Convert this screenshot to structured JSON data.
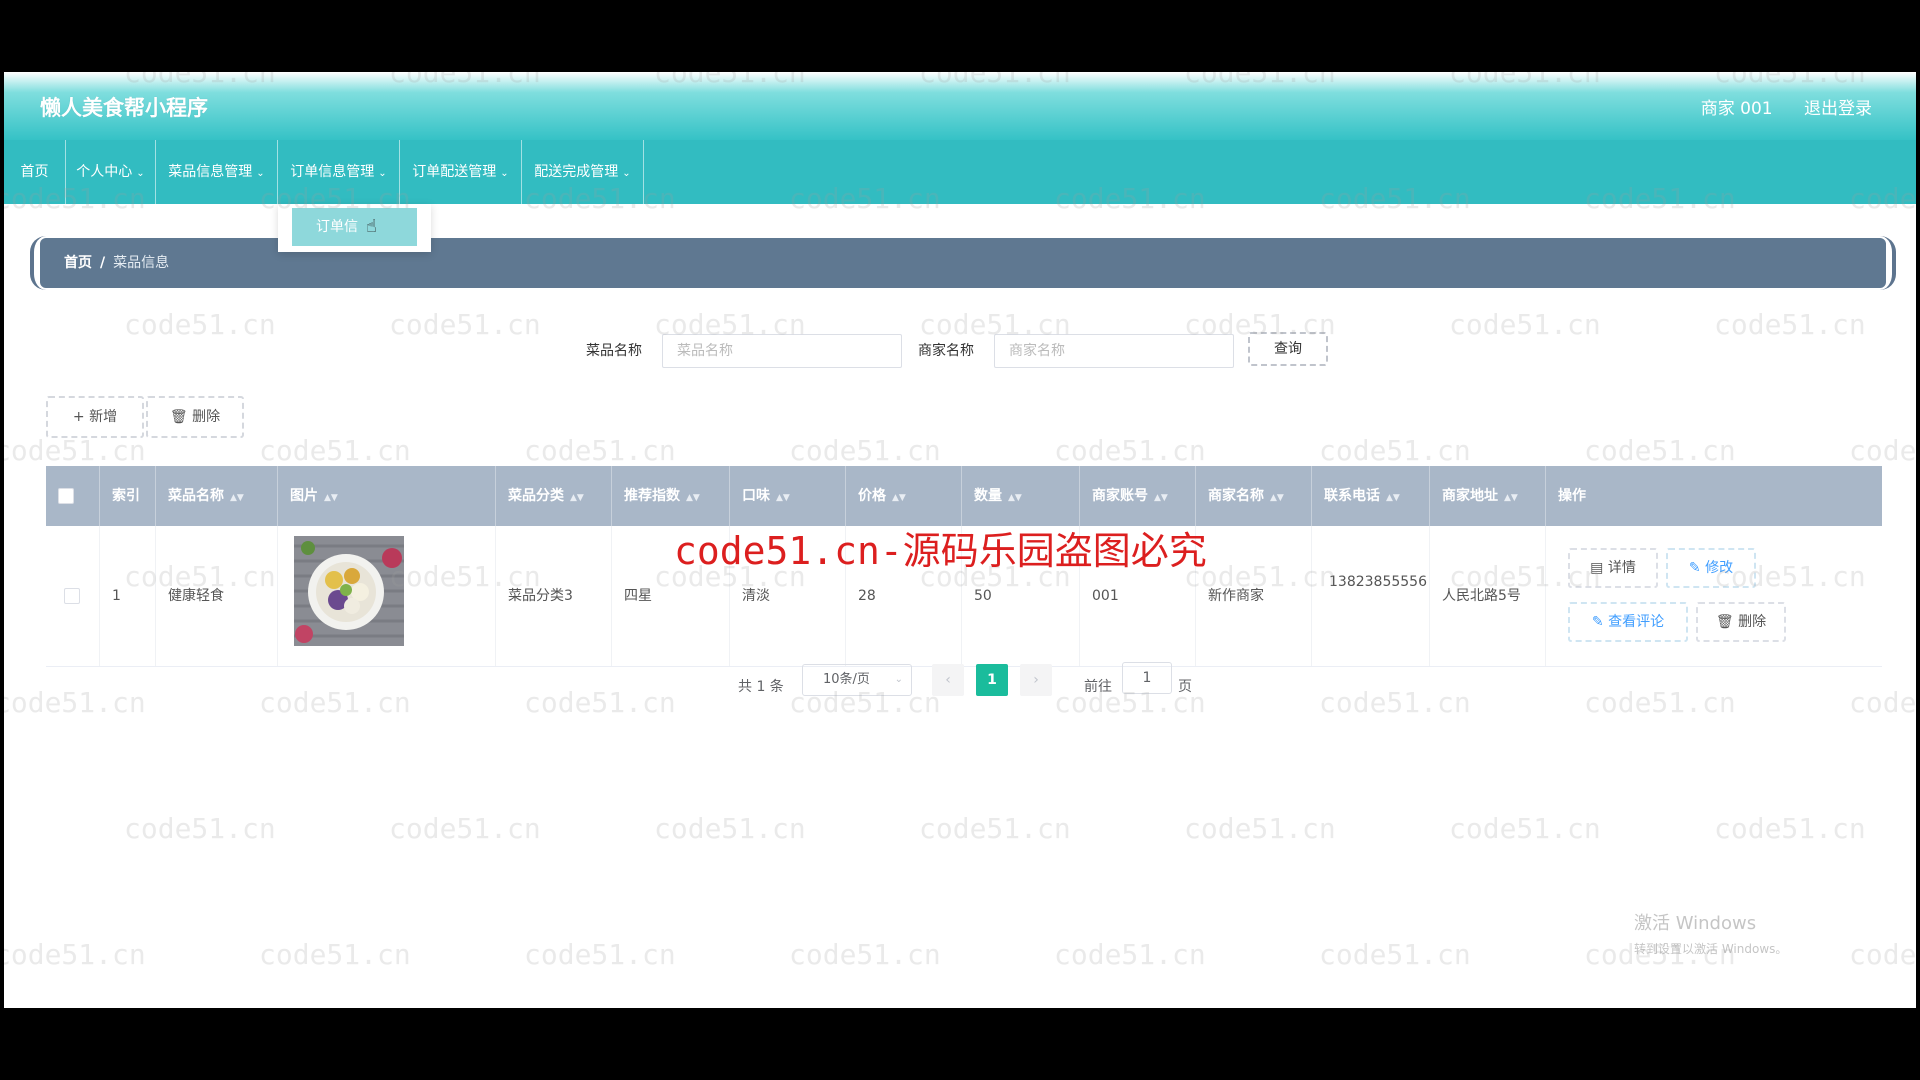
{
  "header": {
    "title": "懒人美食帮小程序",
    "user": "商家 001",
    "logout": "退出登录"
  },
  "nav": {
    "items": [
      {
        "label": "首页",
        "dropdown": false
      },
      {
        "label": "个人中心",
        "dropdown": true
      },
      {
        "label": "菜品信息管理",
        "dropdown": true
      },
      {
        "label": "订单信息管理",
        "dropdown": true
      },
      {
        "label": "订单配送管理",
        "dropdown": true
      },
      {
        "label": "配送完成管理",
        "dropdown": true
      }
    ],
    "dropdown_item": "订单信"
  },
  "breadcrumb": {
    "home": "首页",
    "separator": "/",
    "current": "菜品信息"
  },
  "search": {
    "dish_label": "菜品名称",
    "dish_placeholder": "菜品名称",
    "merchant_label": "商家名称",
    "merchant_placeholder": "商家名称",
    "query_label": "查询"
  },
  "actions": {
    "add_label": "新增",
    "delete_label": "删除"
  },
  "table": {
    "headers": [
      "索引",
      "菜品名称",
      "图片",
      "菜品分类",
      "推荐指数",
      "口味",
      "价格",
      "数量",
      "商家账号",
      "商家名称",
      "联系电话",
      "商家地址",
      "操作"
    ],
    "rows": [
      {
        "index": "1",
        "name": "健康轻食",
        "category": "菜品分类3",
        "rating": "四星",
        "taste": "清淡",
        "price": "28",
        "quantity": "50",
        "account": "001",
        "merchant": "新作商家",
        "phone": "13823855556",
        "address": "人民北路5号"
      }
    ],
    "ops": {
      "detail": "详情",
      "edit": "修改",
      "review": "查看评论",
      "delete": "删除"
    }
  },
  "pagination": {
    "total_text": "共 1 条",
    "page_size": "10条/页",
    "current_page": "1",
    "goto_prefix": "前往",
    "goto_value": "1",
    "goto_suffix": "页"
  },
  "watermark": {
    "text": "code51.cn",
    "banner": "code51.cn-源码乐园盗图必究"
  },
  "windows_activation": {
    "line1": "激活 Windows",
    "line2": "转到设置以激活 Windows。"
  },
  "colors": {
    "header": "#35c2c6",
    "nav": "#32bcc1",
    "breadcrumb": "#5f7891",
    "table_header": "#a9b7c8",
    "page_active": "#1abc9c"
  }
}
